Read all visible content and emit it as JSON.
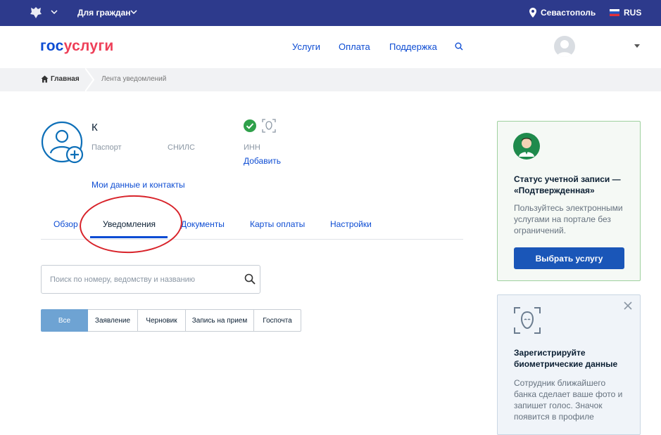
{
  "topbar": {
    "for_citizens": "Для граждан",
    "city": "Севастополь",
    "lang": "RUS"
  },
  "header": {
    "logo_part1": "гос",
    "logo_part2": "услуги",
    "nav": [
      "Услуги",
      "Оплата",
      "Поддержка"
    ]
  },
  "breadcrumb": {
    "home": "Главная",
    "current": "Лента уведомлений"
  },
  "profile": {
    "name": "К",
    "passport_label": "Паспорт",
    "snils_label": "СНИЛС",
    "inn_label": "ИНН",
    "add_link": "Добавить",
    "my_data_link": "Мои данные и контакты"
  },
  "tabs": [
    "Обзор",
    "Уведомления",
    "Документы",
    "Карты оплаты",
    "Настройки"
  ],
  "search": {
    "placeholder": "Поиск по номеру, ведомству и названию"
  },
  "filters": [
    "Все",
    "Заявление",
    "Черновик",
    "Запись на прием",
    "Госпочта"
  ],
  "status_card": {
    "title": "Статус учетной записи — «Подтвержденная»",
    "text": "Пользуйтесь электронными услугами на портале без ограничений.",
    "button": "Выбрать услугу"
  },
  "bio_card": {
    "title": "Зарегистрируйте биометрические данные",
    "text": "Сотрудник ближайшего банка сделает ваше фото и запишет голос. Значок появится в профиле"
  },
  "colors": {
    "topbar": "#2d3a8c",
    "brand_blue": "#0d4cd3",
    "brand_red": "#ee3f58",
    "highlight_ellipse": "#d8232a",
    "active_filter": "#6ea3d3"
  }
}
